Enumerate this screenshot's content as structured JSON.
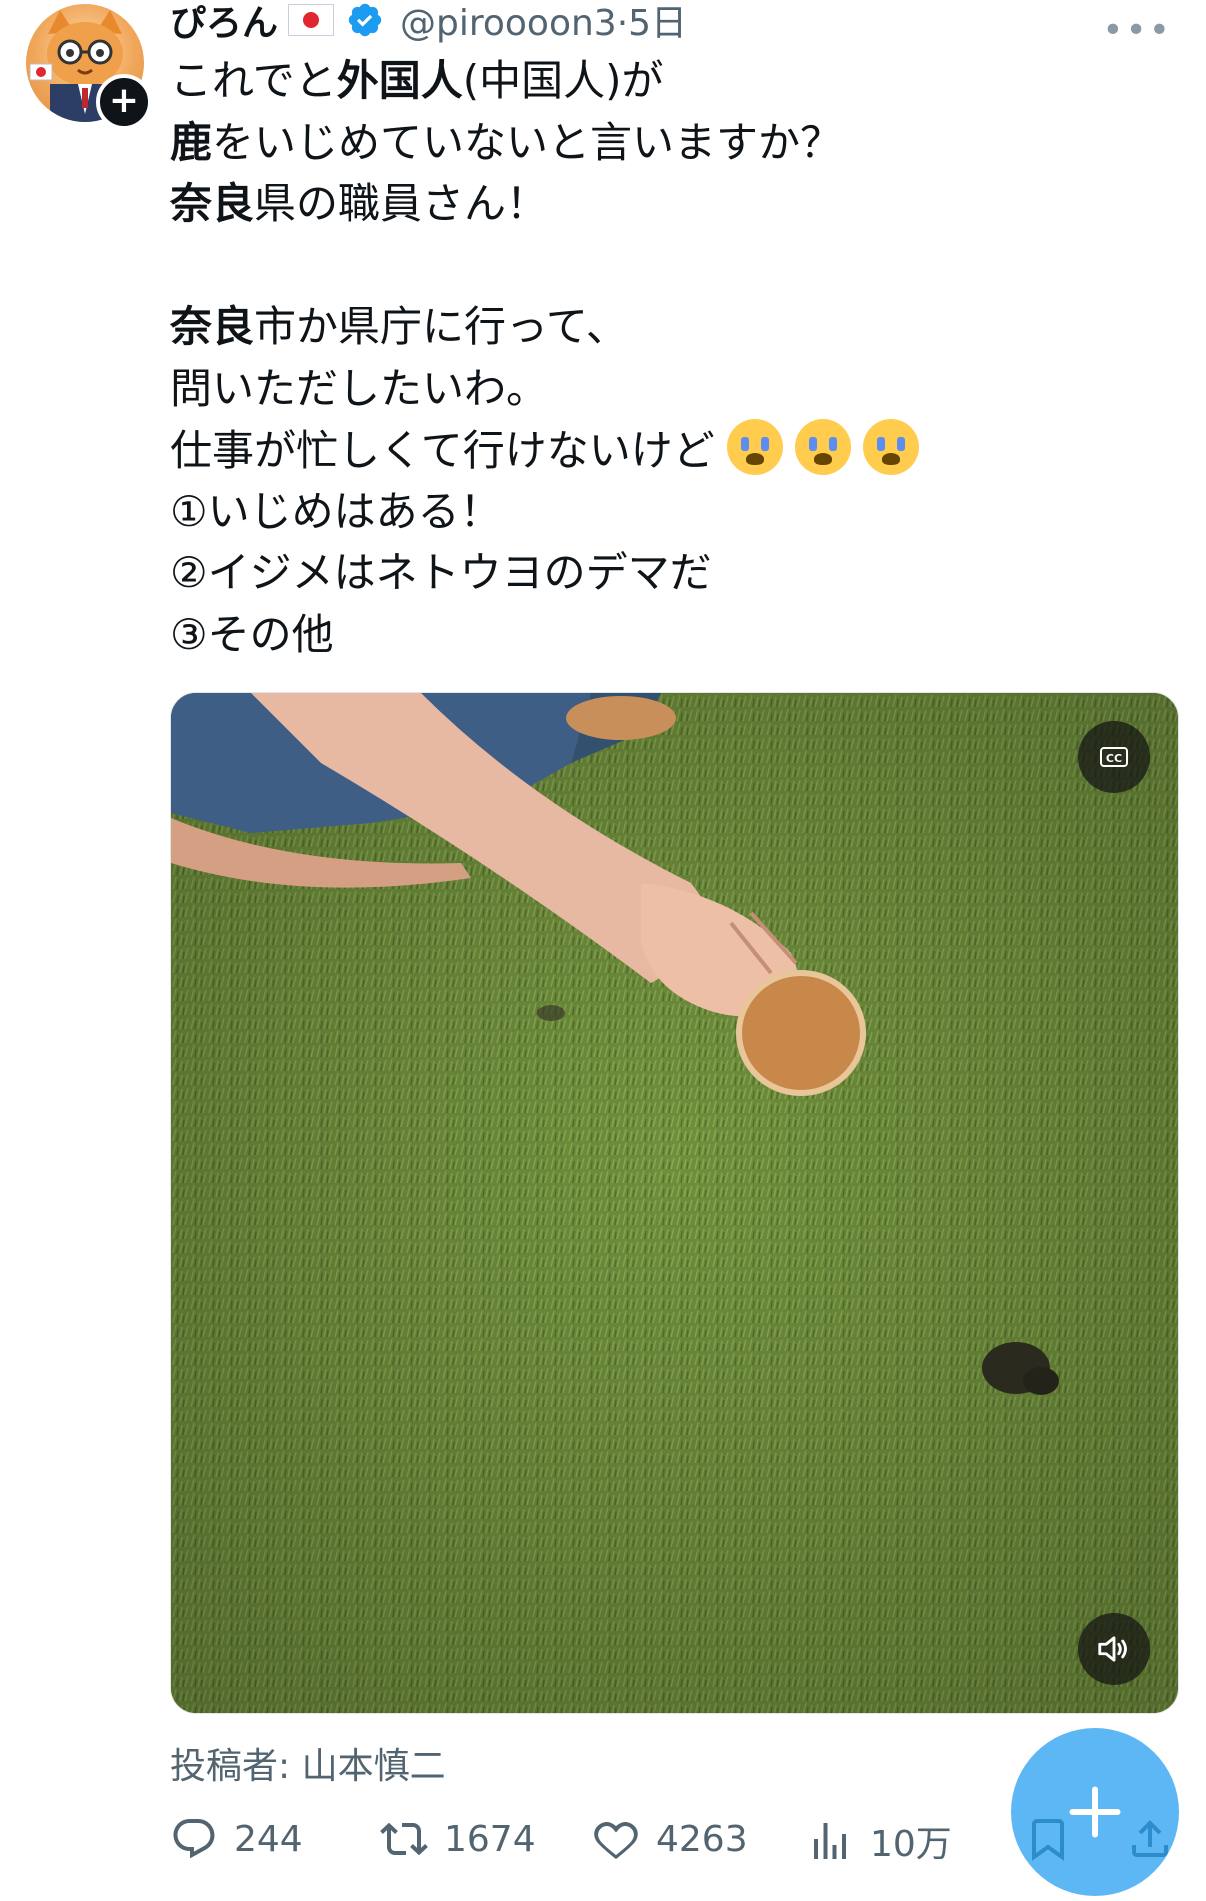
{
  "post": {
    "display_name": "ぴろん",
    "handle": "@piroooon3",
    "separator": "·",
    "time_ago": "5日",
    "more_label": "•••",
    "text": {
      "l1_a": "これでと",
      "l1_b": "外国人",
      "l1_c": "(中国人)が",
      "l2_a": "鹿",
      "l2_b": "をいじめていないと言いますか？",
      "l3_a": "奈良",
      "l3_b": "県の職員さん！",
      "l4_a": "奈良",
      "l4_b": "市か県庁に行って、",
      "l5": "問いただしたいわ。",
      "l6": "仕事が忙しくて行けないけど",
      "l7": "①いじめはある！",
      "l8": "②イジメはネトウヨのデマだ",
      "l9": "③その他"
    },
    "emoji_name": "loudly-crying-face",
    "attribution": "投稿者: 山本慎二",
    "stats": {
      "replies": "244",
      "reposts": "1674",
      "likes": "4263",
      "views": "10万"
    },
    "media": {
      "cc_label": "CC"
    }
  },
  "colors": {
    "accent": "#1d9bf0",
    "text_primary": "#0f1419",
    "text_secondary": "#536471",
    "verified": "#1d9bf0"
  }
}
